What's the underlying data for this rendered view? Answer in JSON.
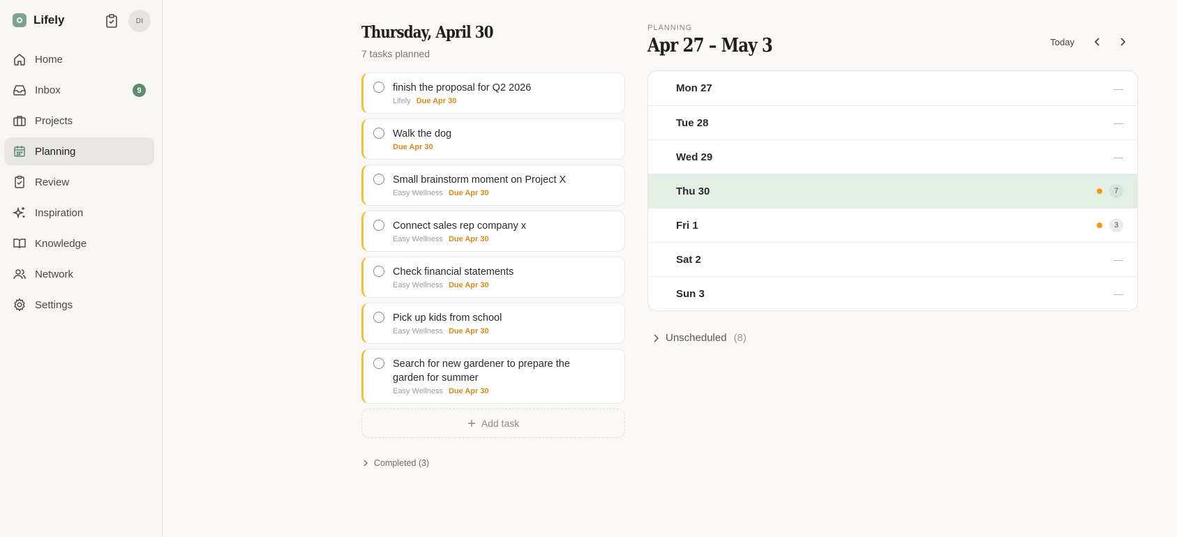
{
  "app": {
    "name": "Lifely"
  },
  "user": {
    "initials": "DI"
  },
  "sidebar": {
    "items": [
      {
        "label": "Home",
        "icon": "home-icon"
      },
      {
        "label": "Inbox",
        "icon": "inbox-icon",
        "badge": "9"
      },
      {
        "label": "Projects",
        "icon": "briefcase-icon"
      },
      {
        "label": "Planning",
        "icon": "calendar-icon",
        "active": true
      },
      {
        "label": "Review",
        "icon": "clipboard-check-icon"
      },
      {
        "label": "Inspiration",
        "icon": "sparkles-icon"
      },
      {
        "label": "Knowledge",
        "icon": "book-icon"
      },
      {
        "label": "Network",
        "icon": "users-icon"
      },
      {
        "label": "Settings",
        "icon": "gear-icon"
      }
    ]
  },
  "day": {
    "title": "Thursday, April 30",
    "subtitle": "7 tasks planned",
    "tasks": [
      {
        "title": "finish the proposal for Q2 2026",
        "project": "Lifely",
        "due": "Due Apr 30"
      },
      {
        "title": "Walk the dog",
        "project": "",
        "due": "Due Apr 30"
      },
      {
        "title": "Small brainstorm moment on Project X",
        "project": "Easy Wellness",
        "due": "Due Apr 30"
      },
      {
        "title": "Connect sales rep company x",
        "project": "Easy Wellness",
        "due": "Due Apr 30"
      },
      {
        "title": "Check financial statements",
        "project": "Easy Wellness",
        "due": "Due Apr 30"
      },
      {
        "title": "Pick up kids from school",
        "project": "Easy Wellness",
        "due": "Due Apr 30"
      },
      {
        "title": "Search for new gardener to prepare the garden for summer",
        "project": "Easy Wellness",
        "due": "Due Apr 30"
      }
    ],
    "add_task_label": "Add task",
    "completed_label": "Completed (3)"
  },
  "planning": {
    "label": "PLANNING",
    "title": "Apr 27 – May 3",
    "today_label": "Today",
    "days": [
      {
        "label": "Mon 27",
        "count": "",
        "dash": "—"
      },
      {
        "label": "Tue 28",
        "count": "",
        "dash": "—"
      },
      {
        "label": "Wed 29",
        "count": "",
        "dash": "—"
      },
      {
        "label": "Thu 30",
        "count": "7",
        "dash": "",
        "today": true
      },
      {
        "label": "Fri 1",
        "count": "3",
        "dash": ""
      },
      {
        "label": "Sat 2",
        "count": "",
        "dash": "—"
      },
      {
        "label": "Sun 3",
        "count": "",
        "dash": "—"
      }
    ],
    "unscheduled_label": "Unscheduled",
    "unscheduled_count": "(8)"
  },
  "colors": {
    "accent_green": "#5f8a6c",
    "today_row": "#e3eee5",
    "task_border": "#f2c230",
    "due": "#d98a1a",
    "dot": "#f39c12"
  }
}
